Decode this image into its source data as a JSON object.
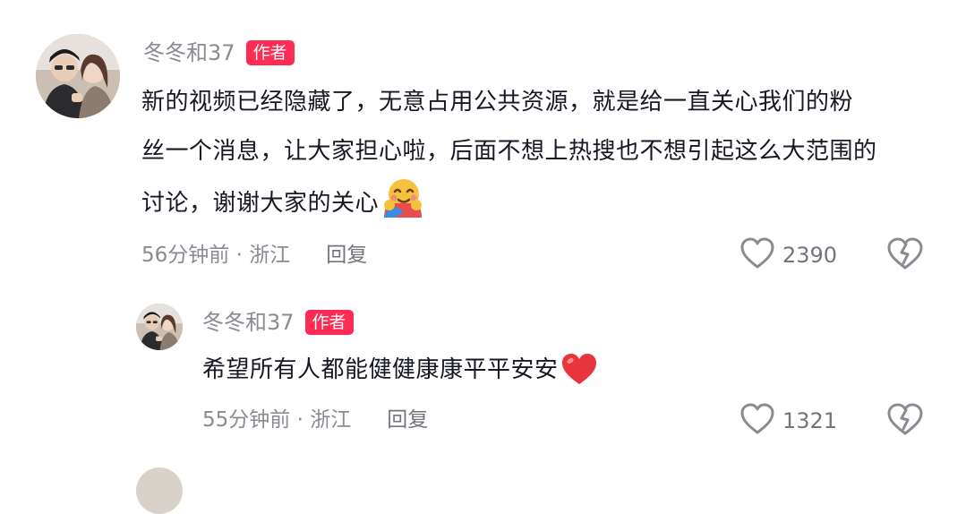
{
  "comments": [
    {
      "username": "冬冬和37",
      "badge": "作者",
      "lines": [
        "新的视频已经隐藏了，无意占用公共资源，就是给一直关心我们的粉",
        "丝一个消息，让大家担心啦，后面不想上热搜也不想引起这么大范围的",
        "讨论，谢谢大家的关心"
      ],
      "emoji": "hug-emoji",
      "time_location": "56分钟前 · 浙江",
      "reply_label": "回复",
      "likes": "2390"
    },
    {
      "username": "冬冬和37",
      "badge": "作者",
      "text": "希望所有人都能健健康康平平安安",
      "emoji": "red-heart-emoji",
      "time_location": "55分钟前 · 浙江",
      "reply_label": "回复",
      "likes": "1321"
    }
  ],
  "icons": {
    "like": "heart-outline-icon",
    "dislike": "broken-heart-icon"
  },
  "colors": {
    "badge": "#fe2c55",
    "secondary_text": "#8a8b91",
    "primary_text": "#161823",
    "heart_emoji": "#e8343c"
  }
}
